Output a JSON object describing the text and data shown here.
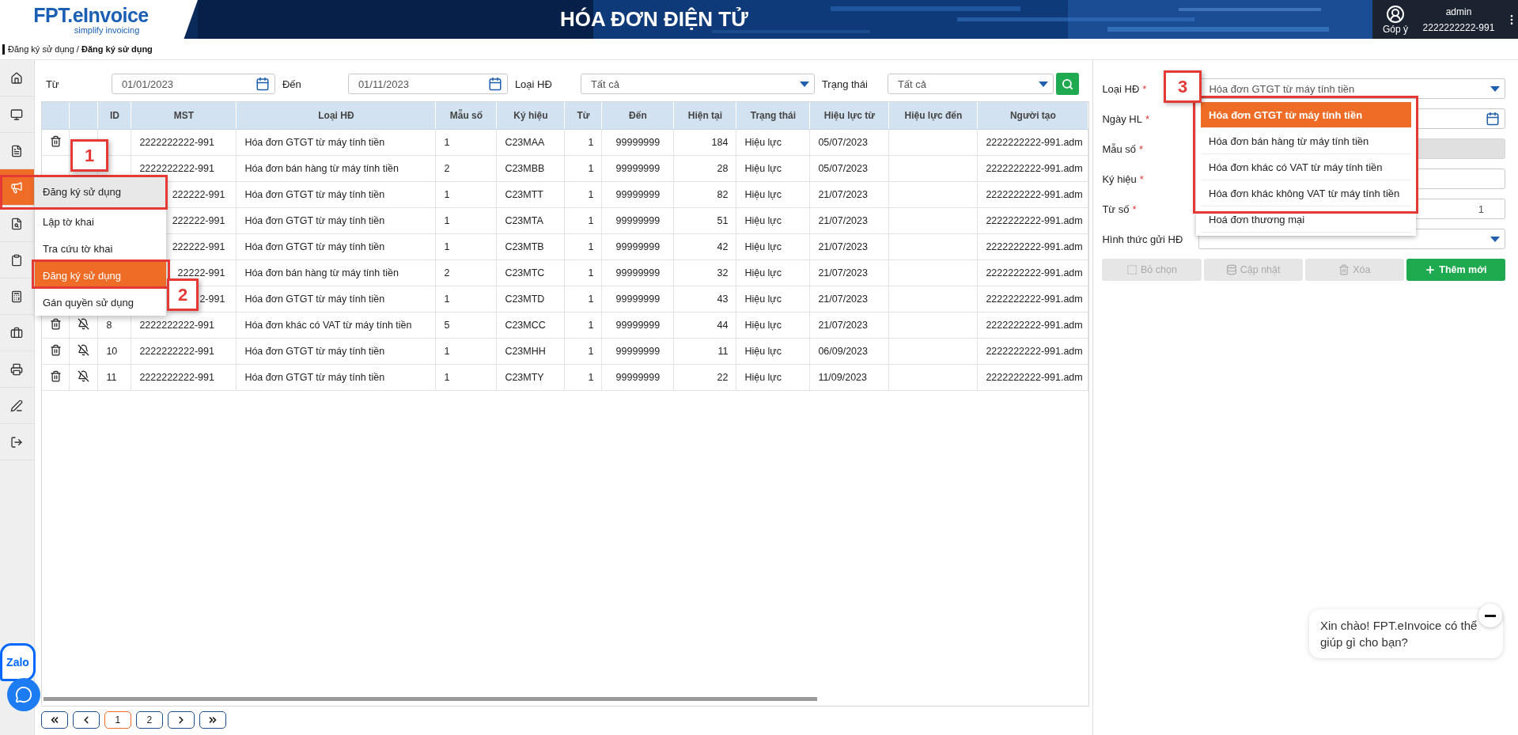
{
  "header": {
    "logo": "FPT.eInvoice",
    "tagline": "simplify invoicing",
    "title": "HÓA ĐƠN ĐIỆN TỬ",
    "feedback": "Góp ý",
    "user": "admin",
    "account": "2222222222-991"
  },
  "breadcrumb": "Đăng ký sử dụng / **Đăng ký sử dụng**",
  "sidebar": {
    "items": [
      {
        "selected": false
      },
      {
        "selected": false
      },
      {
        "selected": false
      },
      {
        "selected": true
      },
      {
        "selected": false
      },
      {
        "selected": false
      },
      {
        "selected": false
      },
      {
        "selected": false
      },
      {
        "selected": false
      },
      {
        "selected": false
      },
      {
        "selected": false
      }
    ]
  },
  "flyout": {
    "title": "Đăng ký sử dụng",
    "items": [
      {
        "label": "Lập tờ khai",
        "selected": false
      },
      {
        "label": "Tra cứu tờ khai",
        "selected": false
      },
      {
        "label": "Đăng ký sử dụng",
        "selected": true
      },
      {
        "label": "Gán quyền sử dụng",
        "selected": false
      }
    ]
  },
  "filters": [
    {
      "label": "Từ",
      "kind": "date",
      "value": "01/01/2023"
    },
    {
      "label": "Đến",
      "kind": "date",
      "value": "01/11/2023"
    },
    {
      "label": "Loại HĐ",
      "kind": "select",
      "value": "Tất cả"
    },
    {
      "label": "Trạng thái",
      "kind": "select",
      "value": "Tất cả"
    }
  ],
  "table": {
    "columns": [
      "ID",
      "MST",
      "Loại HĐ",
      "Mẫu số",
      "Ký hiệu",
      "Từ",
      "Đến",
      "Hiện tại",
      "Trạng thái",
      "Hiệu lực từ",
      "Hiệu lực đến",
      "Người tạo"
    ],
    "rows": [
      {
        "trash": true,
        "bell": false,
        "covered": false,
        "mst": "2222222222-991",
        "type": "Hóa đơn GTGT từ máy tính tiền",
        "template": "1",
        "symbol": "C23MAA",
        "from": "1",
        "to": "99999999",
        "current": "184",
        "status": "Hiệu lực",
        "valid_from": "05/07/2023",
        "creator": "2222222222-991.adm"
      },
      {
        "trash": false,
        "bell": false,
        "covered": false,
        "mst": "2222222222-991",
        "type": "Hóa đơn bán hàng từ máy tính tiền",
        "template": "2",
        "symbol": "C23MBB",
        "from": "1",
        "to": "99999999",
        "current": "28",
        "status": "Hiệu lực",
        "valid_from": "05/07/2023",
        "creator": "2222222222-991.adm"
      },
      {
        "trash": false,
        "bell": false,
        "covered": true,
        "mst": "222222-991",
        "type": "Hóa đơn GTGT từ máy tính tiền",
        "template": "1",
        "symbol": "C23MTT",
        "from": "1",
        "to": "99999999",
        "current": "82",
        "status": "Hiệu lực",
        "valid_from": "21/07/2023",
        "creator": "2222222222-991.adm"
      },
      {
        "trash": false,
        "bell": false,
        "covered": true,
        "mst": "222222-991",
        "type": "Hóa đơn GTGT từ máy tính tiền",
        "template": "1",
        "symbol": "C23MTA",
        "from": "1",
        "to": "99999999",
        "current": "51",
        "status": "Hiệu lực",
        "valid_from": "21/07/2023",
        "creator": "2222222222-991.adm"
      },
      {
        "trash": false,
        "bell": false,
        "covered": true,
        "mst": "222222-991",
        "type": "Hóa đơn GTGT từ máy tính tiền",
        "template": "1",
        "symbol": "C23MTB",
        "from": "1",
        "to": "99999999",
        "current": "42",
        "status": "Hiệu lực",
        "valid_from": "21/07/2023",
        "creator": "2222222222-991.adm"
      },
      {
        "trash": false,
        "bell": false,
        "covered": true,
        "mst": "22222-991",
        "type": "Hóa đơn bán hàng từ máy tính tiền",
        "template": "2",
        "symbol": "C23MTC",
        "from": "1",
        "to": "99999999",
        "current": "32",
        "status": "Hiệu lực",
        "valid_from": "21/07/2023",
        "creator": "2222222222-991.adm"
      },
      {
        "trash": false,
        "bell": false,
        "covered": true,
        "mst": "2-991",
        "type": "Hóa đơn GTGT từ máy tính tiền",
        "template": "1",
        "symbol": "C23MTD",
        "from": "1",
        "to": "99999999",
        "current": "43",
        "status": "Hiệu lực",
        "valid_from": "21/07/2023",
        "creator": "2222222222-991.adm"
      },
      {
        "trash": true,
        "bell": true,
        "covered": false,
        "id": "8",
        "mst": "2222222222-991",
        "type": "Hóa đơn khác có VAT từ máy tính tiền",
        "template": "5",
        "symbol": "C23MCC",
        "from": "1",
        "to": "99999999",
        "current": "44",
        "status": "Hiệu lực",
        "valid_from": "21/07/2023",
        "creator": "2222222222-991.adm"
      },
      {
        "trash": true,
        "bell": true,
        "covered": false,
        "id": "10",
        "mst": "2222222222-991",
        "type": "Hóa đơn GTGT từ máy tính tiền",
        "template": "1",
        "symbol": "C23MHH",
        "from": "1",
        "to": "99999999",
        "current": "11",
        "status": "Hiệu lực",
        "valid_from": "06/09/2023",
        "creator": "2222222222-991.adm"
      },
      {
        "trash": true,
        "bell": true,
        "covered": false,
        "id": "11",
        "mst": "2222222222-991",
        "type": "Hóa đơn GTGT từ máy tính tiền",
        "template": "1",
        "symbol": "C23MTY",
        "from": "1",
        "to": "99999999",
        "current": "22",
        "status": "Hiệu lực",
        "valid_from": "11/09/2023",
        "creator": "2222222222-991.adm"
      }
    ]
  },
  "pagination": {
    "pages": [
      {
        "label": "1",
        "selected": true
      },
      {
        "label": "2",
        "selected": false
      }
    ]
  },
  "form": {
    "fields": [
      {
        "label": "Loại HĐ",
        "required_mark": "*",
        "kind": "select",
        "disabled": false,
        "value": "Hóa đơn GTGT từ máy tính tiền"
      },
      {
        "label": "Ngày HL",
        "required_mark": "*",
        "kind": "date",
        "disabled": false
      },
      {
        "label": "Mẫu số",
        "required_mark": "*",
        "kind": "text",
        "disabled": true
      },
      {
        "label": "Ký hiệu",
        "required_mark": "*",
        "kind": "text",
        "disabled": false
      },
      {
        "label": "Từ số",
        "required_mark": "*",
        "kind": "number",
        "disabled": false,
        "value": "1"
      },
      {
        "label": "Hình thức gửi HĐ",
        "kind": "select",
        "disabled": false
      }
    ],
    "buttons": [
      {
        "label": "Bỏ chọn",
        "disabled": true
      },
      {
        "label": "Cập nhật",
        "disabled": true
      },
      {
        "label": "Xóa",
        "disabled": true
      },
      {
        "label": "Thêm mới",
        "disabled": false
      }
    ]
  },
  "type_dropdown": {
    "options": [
      {
        "label": "Hóa đơn GTGT từ máy tính tiền",
        "selected": true
      },
      {
        "label": "Hóa đơn bán hàng từ máy tính tiền",
        "selected": false
      },
      {
        "label": "Hóa đơn khác có VAT từ máy tính tiền",
        "selected": false
      },
      {
        "label": "Hóa đơn khác không VAT từ máy tính tiền",
        "selected": false
      },
      {
        "label": "Hoá đơn thương mại",
        "selected": false
      }
    ]
  },
  "callouts": [
    {
      "label": "1"
    },
    {
      "label": "2"
    },
    {
      "label": "3"
    }
  ],
  "zalo": {
    "label": "Zalo"
  },
  "chat_bubble": {
    "text": "Xin chào! FPT.eInvoice có thể giúp gì cho bạn?"
  }
}
